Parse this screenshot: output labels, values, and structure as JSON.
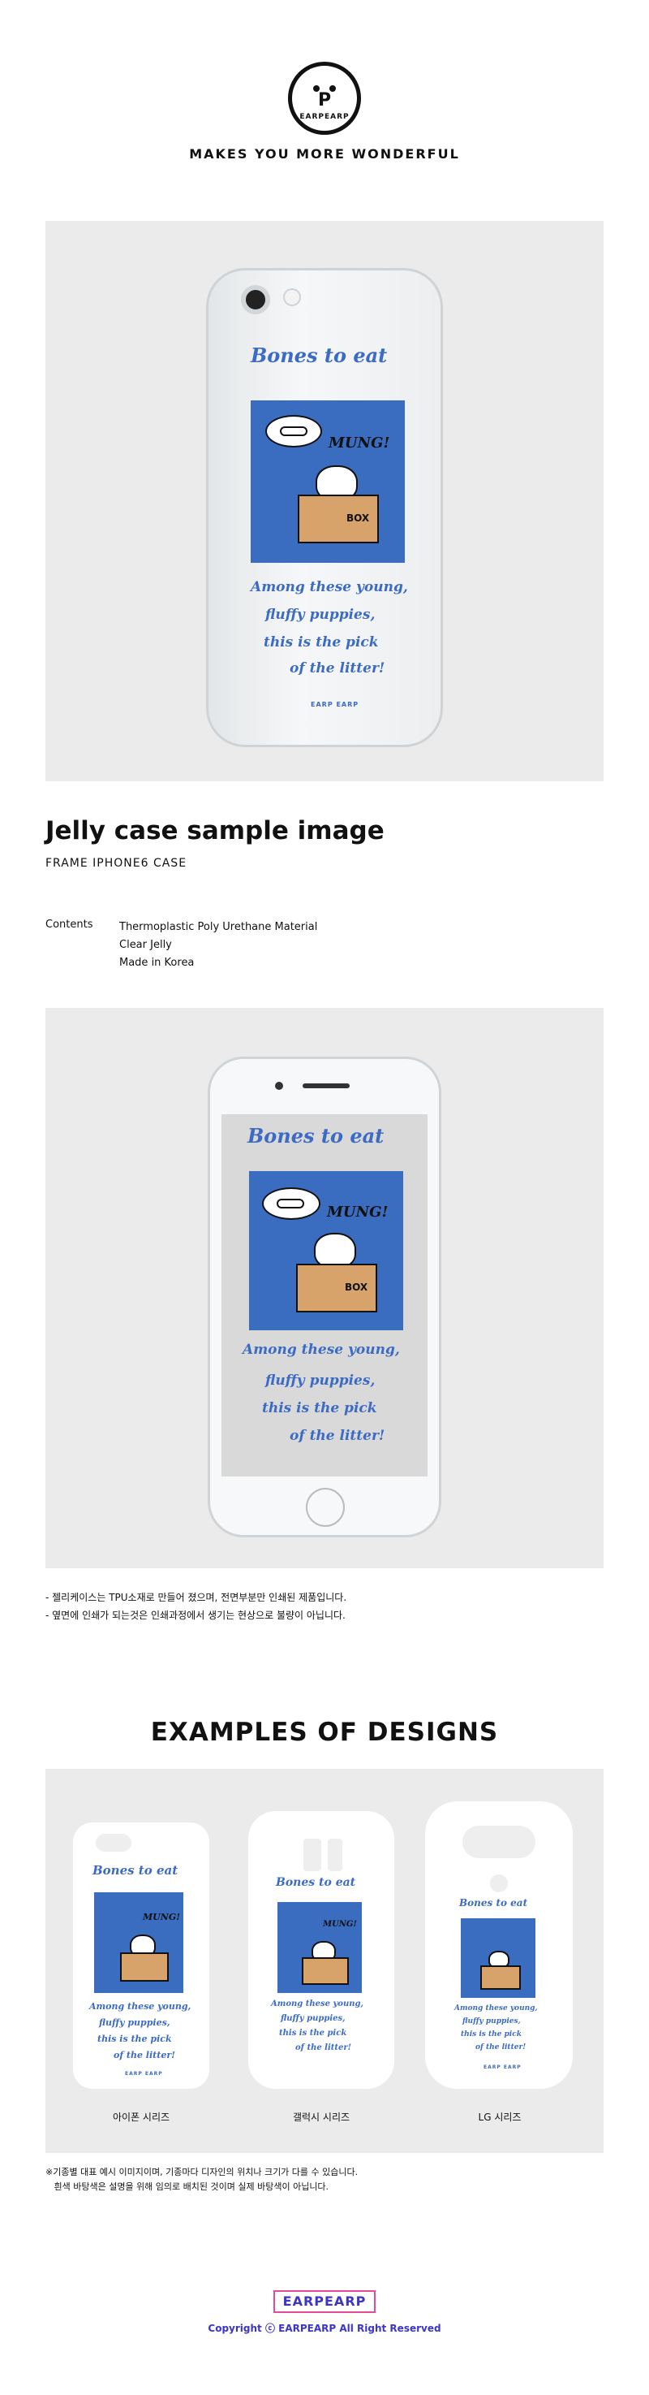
{
  "header": {
    "logo_letter": "P",
    "logo_text": "EARPEARP",
    "tagline": "MAKES YOU MORE WONDERFUL"
  },
  "artwork": {
    "title": "Bones to eat",
    "bubble_text": "MUNG!",
    "box_label": "BOX",
    "lines": [
      "Among these young,",
      "fluffy puppies,",
      "this is the pick",
      "of the litter!"
    ],
    "brand": "EARP EARP"
  },
  "product": {
    "title": "Jelly case sample image",
    "subtitle": "FRAME IPHONE6 CASE",
    "contents_label": "Contents",
    "contents": [
      "Thermoplastic Poly Urethane Material",
      "Clear Jelly",
      "Made in Korea"
    ]
  },
  "notes": [
    "- 젤리케이스는 TPU소재로 만들어 졌으며, 전면부분만 인쇄된 제품입니다.",
    "- 옆면에 인쇄가 되는것은 인쇄과정에서 생기는 현상으로 불량이 아닙니다."
  ],
  "examples": {
    "title": "EXAMPLES OF DESIGNS",
    "items": [
      {
        "label": "아이폰 시리즈"
      },
      {
        "label": "갤럭시 시리즈"
      },
      {
        "label": "LG 시리즈"
      }
    ],
    "footnote": [
      "※기종별 대표 예시 이미지이며, 기종마다 디자인의 위치나 크기가 다를 수 있습니다.",
      "   흰색 바탕색은 설명을 위해 임의로 배치된 것이며 실제 바탕색이 아닙니다."
    ]
  },
  "footer": {
    "logo": "EARPEARP",
    "copyright": "Copyright ⓒ EARPEARP All Right Reserved"
  },
  "colors": {
    "art_blue": "#3a6cbf",
    "panel": "#ebebeb",
    "footer_text": "#3b36c8",
    "footer_border": "#e44a97"
  }
}
